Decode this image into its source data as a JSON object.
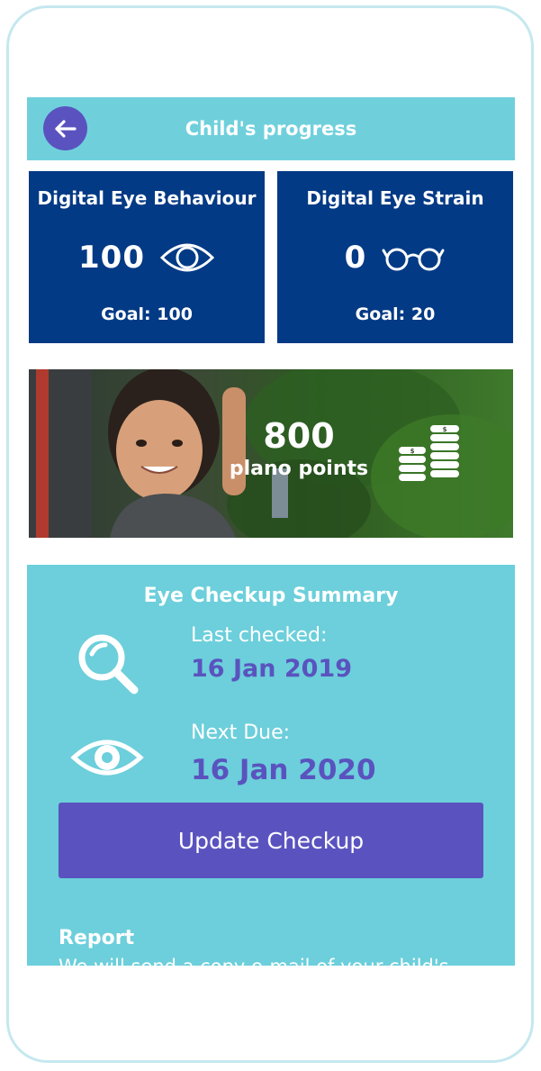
{
  "header": {
    "title": "Child's progress",
    "back_icon": "arrow-left-icon"
  },
  "metrics": [
    {
      "title": "Digital Eye Behaviour",
      "value": "100",
      "icon": "eye-icon",
      "goal": "Goal: 100"
    },
    {
      "title": "Digital Eye Strain",
      "value": "0",
      "icon": "glasses-icon",
      "goal": "Goal: 20"
    }
  ],
  "points": {
    "value": "800",
    "label": "plano points",
    "icon": "coins-icon"
  },
  "checkup": {
    "title": "Eye Checkup Summary",
    "last_checked_label": "Last checked:",
    "last_checked_date": "16 Jan 2019",
    "next_due_label": "Next Due:",
    "next_due_date": "16 Jan 2020",
    "update_button": "Update Checkup",
    "report_title": "Report",
    "report_text": "We will send a copy e-mail of your child's"
  },
  "colors": {
    "header_bg": "#6fd0dc",
    "card_bg": "#033a85",
    "accent": "#5a53bf",
    "panel_bg": "#6ccfdb"
  }
}
